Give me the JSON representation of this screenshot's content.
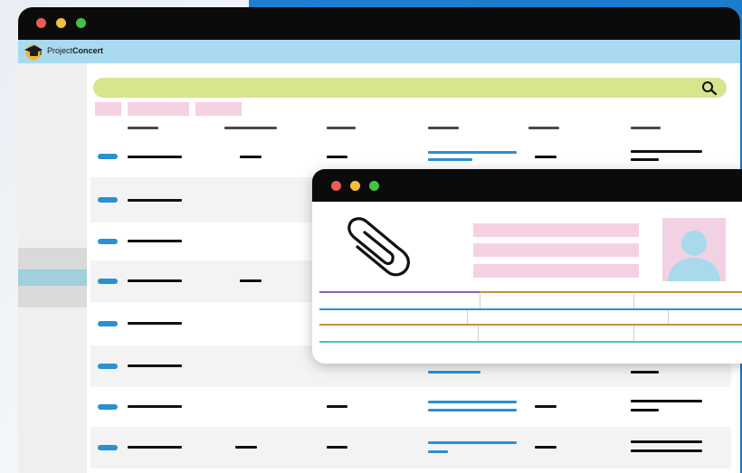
{
  "app": {
    "brand_prefix": "Project",
    "brand_suffix": "Concert"
  },
  "window_controls": [
    "close-dot",
    "minimize-dot",
    "maximize-dot"
  ],
  "colors": {
    "close": "#ed5b55",
    "minimize": "#f4bf3a",
    "maximize": "#43c148",
    "brand_bar": "#a9daf0",
    "search_bar": "#d5e68c",
    "chip": "#f5d1e3",
    "accent_blue": "#2b8fd4",
    "line_purple": "#8a62b3",
    "line_gold": "#c2913a",
    "line_blue": "#2b8fd4",
    "line_teal": "#4cc2cf"
  },
  "icons": {
    "search": "search-icon",
    "attachment": "paperclip-icon",
    "profile": "user-avatar-icon",
    "logo": "graduation-cap-logo"
  },
  "sidebar": {
    "selected_index": 1
  }
}
